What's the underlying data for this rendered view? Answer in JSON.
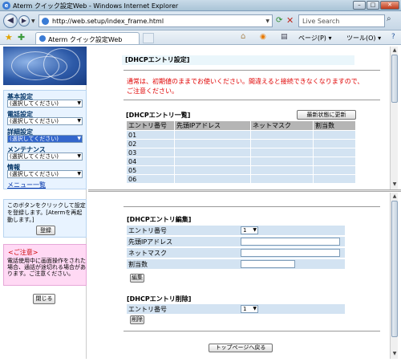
{
  "window": {
    "title": "Aterm クイック設定Web - Windows Internet Explorer",
    "minimize": "–",
    "maximize": "□",
    "close": "✕"
  },
  "address_bar": {
    "url": "http://web.setup/index_frame.html",
    "search_placeholder": "Live Search"
  },
  "tab": {
    "label": "Aterm クイック設定Web"
  },
  "command_bar": {
    "page_menu": "ページ(P) ▾",
    "tools_menu": "ツール(O) ▾",
    "help_icon": "?"
  },
  "sidebar": {
    "menus": [
      {
        "category": "基本設定",
        "selected": "(選択してください)"
      },
      {
        "category": "電話設定",
        "selected": "(選択してください)"
      },
      {
        "category": "詳細設定",
        "selected": "(選択してください)"
      },
      {
        "category": "メンテナンス",
        "selected": "(選択してください)"
      },
      {
        "category": "情報",
        "selected": "(選択してください)"
      }
    ],
    "menu_list_link": "メニュー一覧",
    "register_note": "このボタンをクリックして設定を登録します。[Atermを再起動します。]",
    "register_button": "登録",
    "caution_heading": "<ご注意>",
    "caution_text": "電話使用中に画面操作をされた場合、通話が途切れる場合があります。ご注意ください。",
    "close_button": "閉じる"
  },
  "top_frame": {
    "title": "[DHCPエントリ設定]",
    "warning": "通常は、初期値のままでお使いください。間違えると接続できなくなりますので、ご注意ください。",
    "list_title": "[DHCPエントリ一覧]",
    "refresh_button": "最新状態に更新",
    "table": {
      "headers": [
        "エントリ番号",
        "先頭IPアドレス",
        "ネットマスク",
        "割当数"
      ],
      "rows": [
        [
          "01",
          "",
          "",
          ""
        ],
        [
          "02",
          "",
          "",
          ""
        ],
        [
          "03",
          "",
          "",
          ""
        ],
        [
          "04",
          "",
          "",
          ""
        ],
        [
          "05",
          "",
          "",
          ""
        ],
        [
          "06",
          "",
          "",
          ""
        ]
      ]
    }
  },
  "bottom_frame": {
    "edit_title": "[DHCPエントリ編集]",
    "edit_fields": {
      "entry_label": "エントリ番号",
      "entry_value": "1",
      "ip_label": "先頭IPアドレス",
      "netmask_label": "ネットマスク",
      "count_label": "割当数"
    },
    "edit_button": "編集",
    "delete_title": "[DHCPエントリ削除]",
    "delete_entry_label": "エントリ番号",
    "delete_entry_value": "1",
    "delete_button": "削除",
    "top_page_button": "トップページへ戻る"
  }
}
